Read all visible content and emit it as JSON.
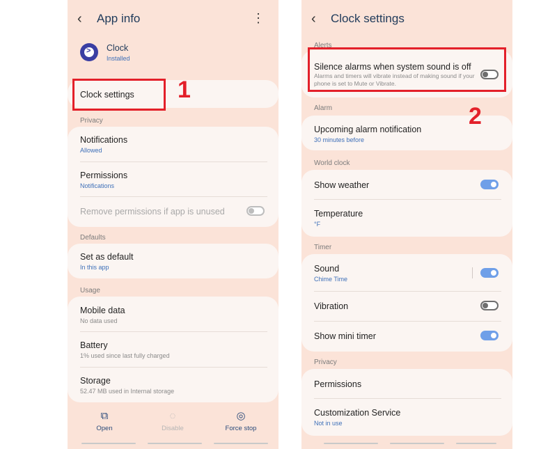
{
  "left": {
    "header_title": "App info",
    "app_name": "Clock",
    "app_status": "Installed",
    "clock_settings_label": "Clock settings",
    "annotation_number": "1",
    "privacy_section": "Privacy",
    "notifications_title": "Notifications",
    "notifications_sub": "Allowed",
    "permissions_title": "Permissions",
    "permissions_sub": "Notifications",
    "remove_permissions_label": "Remove permissions if app is unused",
    "defaults_section": "Defaults",
    "set_default_title": "Set as default",
    "set_default_sub": "In this app",
    "usage_section": "Usage",
    "mobile_data_title": "Mobile data",
    "mobile_data_sub": "No data used",
    "battery_title": "Battery",
    "battery_sub": "1% used since last fully charged",
    "storage_title": "Storage",
    "storage_sub": "52.47 MB used in Internal storage",
    "bottom_open": "Open",
    "bottom_disable": "Disable",
    "bottom_force_stop": "Force stop"
  },
  "right": {
    "header_title": "Clock settings",
    "alerts_section": "Alerts",
    "silence_title": "Silence alarms when system sound is off",
    "silence_desc": "Alarms and timers will vibrate instead of making sound if your phone is set to Mute or Vibrate.",
    "annotation_number": "2",
    "alarm_section": "Alarm",
    "upcoming_title": "Upcoming alarm notification",
    "upcoming_sub": "30 minutes before",
    "world_clock_section": "World clock",
    "show_weather_title": "Show weather",
    "temperature_title": "Temperature",
    "temperature_sub": "°F",
    "timer_section": "Timer",
    "sound_title": "Sound",
    "sound_sub": "Chime Time",
    "vibration_title": "Vibration",
    "mini_timer_title": "Show mini timer",
    "privacy_section": "Privacy",
    "permissions_title": "Permissions",
    "customization_title": "Customization Service",
    "customization_sub": "Not in use"
  },
  "toggles": {
    "remove_permissions": "off",
    "silence_alarms": "off",
    "show_weather": "on",
    "sound": "on",
    "vibration": "off",
    "show_mini_timer": "on"
  },
  "icons": {
    "back": "chevron-left-icon",
    "more": "more-vert-icon",
    "open": "open-external-icon",
    "disable": "disable-icon",
    "force_stop": "force-stop-icon"
  },
  "colors": {
    "panel_bg": "#fbe3d8",
    "card_bg": "#fbf5f2",
    "accent_blue": "#3d6fb8",
    "toggle_on": "#6f9fe8",
    "annotation_red": "#e3202a"
  }
}
